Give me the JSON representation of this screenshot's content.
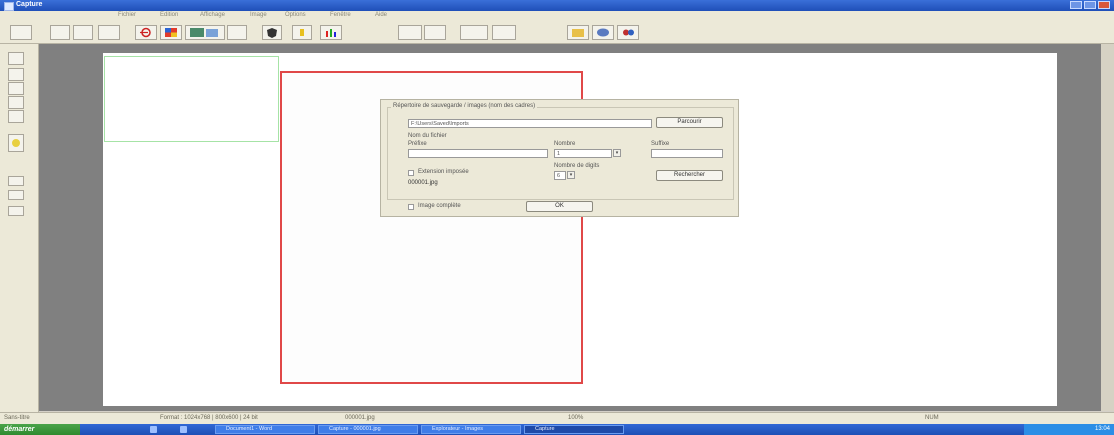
{
  "window": {
    "title": "Capture"
  },
  "menu": [
    "Fichier",
    "Edition",
    "Affichage",
    "Image",
    "Options",
    "Fenêtre",
    "Aide"
  ],
  "toolbar": {
    "icons": [
      "new-icon",
      "open-icon",
      "save-icon",
      "copy-icon",
      "undo-icon",
      "color-icon",
      "screen-icon",
      "zoom-icon",
      "shield-icon",
      "brightness-icon",
      "levels-icon",
      "tool-icon",
      "tool-icon",
      "tool-icon",
      "tool-icon",
      "folder-icon",
      "sphere-icon",
      "settings-icon"
    ]
  },
  "dialog": {
    "group_title": "Répertoire de sauvegarde / images (nom des cadres)",
    "path_value": "F:\\Users\\Saved\\Imports",
    "browse_label": "Parcourir",
    "filename_heading": "Nom du fichier",
    "prefix_label": "Préfixe",
    "prefix_value": "",
    "number_label": "Nombre",
    "number_value": "1",
    "suffix_label": "Suffixe",
    "suffix_value": "",
    "auto_extension_label": "Extension imposée",
    "digits_label": "Nombre de digits",
    "digits_value": "6",
    "search_label": "Rechercher",
    "sample_filename": "000001.jpg",
    "full_image_label": "Image complète",
    "ok_label": "OK"
  },
  "status": {
    "left": "Sans-titre",
    "format": "Format : 1024x768 | 800x600 | 24 bit",
    "file": "000001.jpg",
    "zoom": "100%",
    "mode": "NUM"
  },
  "taskbar": {
    "start_label": "démarrer",
    "tasks": [
      "Document1 - Word",
      "Capture - 000001.jpg",
      "Explorateur - Images",
      "Capture"
    ],
    "clock": "13:04"
  }
}
